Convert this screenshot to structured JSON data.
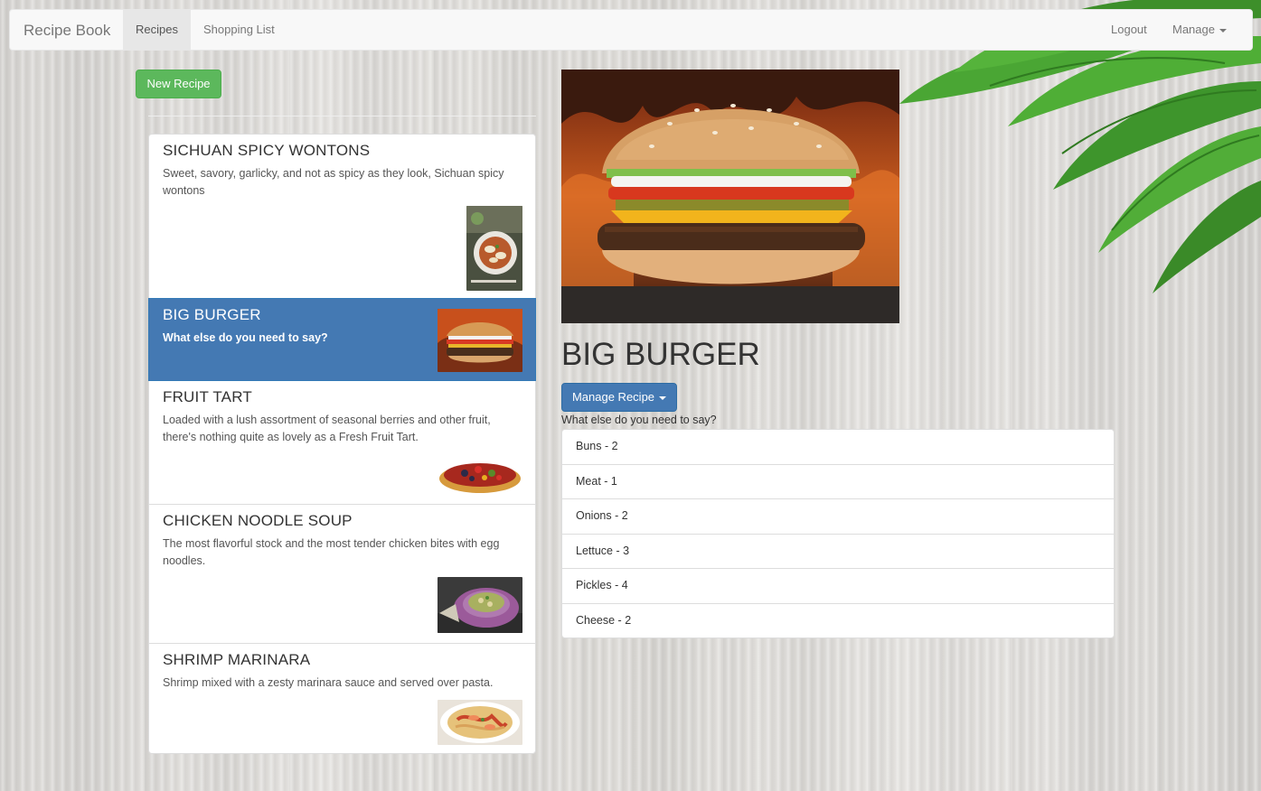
{
  "navbar": {
    "brand": "Recipe Book",
    "links": [
      {
        "label": "Recipes",
        "active": true
      },
      {
        "label": "Shopping List",
        "active": false
      }
    ],
    "logout": "Logout",
    "manage": "Manage"
  },
  "recipes_panel": {
    "new_recipe_label": "New Recipe",
    "items": [
      {
        "name": "SICHUAN SPICY WONTONS",
        "description": "Sweet, savory, garlicky, and not as spicy as they look, Sichuan spicy wontons",
        "image": "wontons-bowl",
        "active": false
      },
      {
        "name": "BIG BURGER",
        "description": "What else do you need to say?",
        "image": "burger",
        "active": true
      },
      {
        "name": "FRUIT TART",
        "description": "Loaded with a lush assortment of seasonal berries and other fruit, there's nothing quite as lovely as a Fresh Fruit Tart.",
        "image": "fruit-tart",
        "active": false
      },
      {
        "name": "CHICKEN NOODLE SOUP",
        "description": "The most flavorful stock and the most tender chicken bites with egg noodles.",
        "image": "soup-bowl",
        "active": false
      },
      {
        "name": "SHRIMP MARINARA",
        "description": "Shrimp mixed with a zesty marinara sauce and served over pasta.",
        "image": "shrimp-pasta",
        "active": false
      }
    ]
  },
  "detail": {
    "title": "BIG BURGER",
    "manage_label": "Manage Recipe",
    "description": "What else do you need to say?",
    "image": "burger",
    "ingredients": [
      "Buns - 2",
      "Meat - 1",
      "Onions - 2",
      "Lettuce - 3",
      "Pickles - 4",
      "Cheese - 2"
    ]
  },
  "colors": {
    "primary": "#4479b3",
    "success": "#5cb85c",
    "navbar_bg": "#f8f8f8"
  }
}
